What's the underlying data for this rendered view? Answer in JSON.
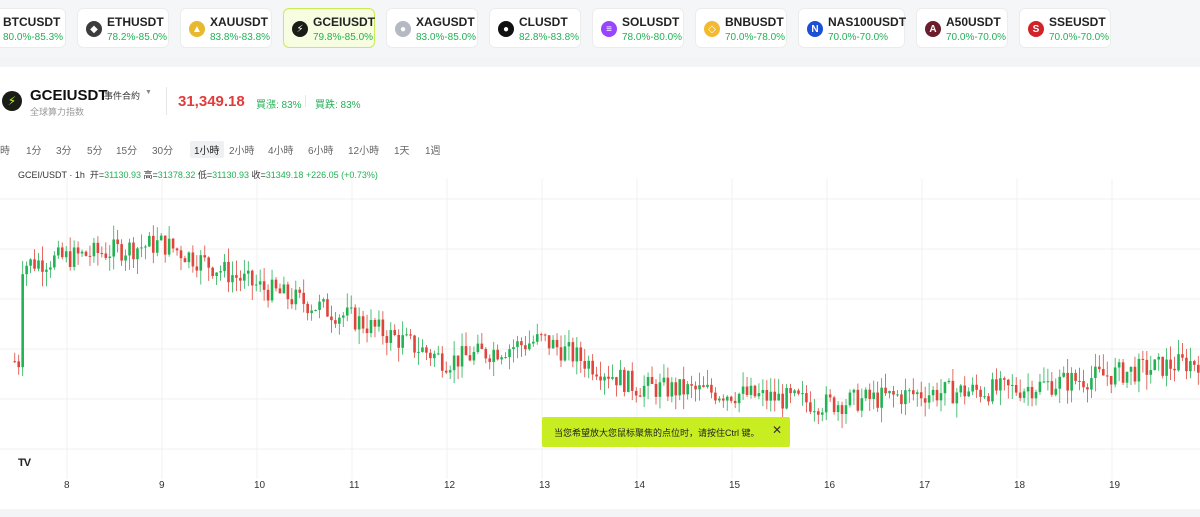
{
  "tickers": [
    {
      "symbol": "BTCUSDT",
      "range": "80.0%-85.3%",
      "icon": "bitcoin-icon",
      "icon_color": "#f7931a",
      "glyph": "₿"
    },
    {
      "symbol": "ETHUSDT",
      "range": "78.2%-85.0%",
      "icon": "ethereum-icon",
      "icon_color": "#3c3c3d",
      "glyph": "◆"
    },
    {
      "symbol": "XAUUSDT",
      "range": "83.8%-83.8%",
      "icon": "gold-icon",
      "icon_color": "#e8b92e",
      "glyph": "▲"
    },
    {
      "symbol": "GCEIUSDT",
      "range": "79.8%-85.0%",
      "icon": "lightning-icon",
      "icon_color": "#1a1d16",
      "glyph": "⚡"
    },
    {
      "symbol": "XAGUSDT",
      "range": "83.0%-85.0%",
      "icon": "silver-icon",
      "icon_color": "#b5b9c2",
      "glyph": "●"
    },
    {
      "symbol": "CLUSDT",
      "range": "82.8%-83.8%",
      "icon": "oil-drop-icon",
      "icon_color": "#111111",
      "glyph": "●"
    },
    {
      "symbol": "SOLUSDT",
      "range": "78.0%-80.0%",
      "icon": "solana-icon",
      "icon_color": "#9945ff",
      "glyph": "≡"
    },
    {
      "symbol": "BNBUSDT",
      "range": "70.0%-78.0%",
      "icon": "bnb-icon",
      "icon_color": "#f3ba2f",
      "glyph": "◇"
    },
    {
      "symbol": "NAS100USDT",
      "range": "70.0%-70.0%",
      "icon": "nas-icon",
      "icon_color": "#1a4fd6",
      "glyph": "N"
    },
    {
      "symbol": "A50USDT",
      "range": "70.0%-70.0%",
      "icon": "a50-icon",
      "icon_color": "#6b1d2b",
      "glyph": "A"
    },
    {
      "symbol": "SSEUSDT",
      "range": "70.0%-70.0%",
      "icon": "sse-icon",
      "icon_color": "#d2232a",
      "glyph": "S"
    }
  ],
  "header": {
    "symbol": "GCEIUSDT",
    "contract_type": "事件合約",
    "subtitle": "全球算力指数",
    "price": "31,349.18",
    "up_label": "買漲: 83%",
    "down_label": "買跌: 83%"
  },
  "timeframes": [
    "時",
    "1分",
    "3分",
    "5分",
    "15分",
    "30分",
    "1小時",
    "2小時",
    "4小時",
    "6小時",
    "12小時",
    "1天",
    "1週"
  ],
  "selected_timeframe": "1小時",
  "ohlc": {
    "pair": "GCEI/USDT · 1h",
    "open_label": "开=",
    "open": "31130.93",
    "high_label": "高=",
    "high": "31378.32",
    "low_label": "低=",
    "low": "31130.93",
    "close_label": "收=",
    "close": "31349.18",
    "change": "+226.05 (+0.73%)"
  },
  "toast": {
    "text": "当您希望放大您鼠标聚焦的点位时，请按住Ctrl 键。",
    "close_glyph": "✕"
  },
  "tv_logo": "TV",
  "chart_data": {
    "type": "candlestick",
    "x_ticks": [
      "8",
      "9",
      "10",
      "11",
      "12",
      "13",
      "14",
      "15",
      "16",
      "17",
      "18",
      "19"
    ],
    "colors": {
      "up": "#21b254",
      "down": "#e0453b"
    },
    "segments": [
      {
        "from_day": 7.5,
        "to_day": 9.0,
        "start": 31900,
        "end": 32000
      },
      {
        "from_day": 9.0,
        "to_day": 10.0,
        "start": 32000,
        "end": 31800
      },
      {
        "from_day": 10.0,
        "to_day": 11.0,
        "start": 31800,
        "end": 31650
      },
      {
        "from_day": 11.0,
        "to_day": 12.0,
        "start": 31650,
        "end": 31450
      },
      {
        "from_day": 12.0,
        "to_day": 13.0,
        "start": 31450,
        "end": 31550
      },
      {
        "from_day": 13.0,
        "to_day": 14.0,
        "start": 31550,
        "end": 31330
      },
      {
        "from_day": 14.0,
        "to_day": 15.0,
        "start": 31330,
        "end": 31300
      },
      {
        "from_day": 15.0,
        "to_day": 16.0,
        "start": 31300,
        "end": 31250
      },
      {
        "from_day": 16.0,
        "to_day": 17.0,
        "start": 31250,
        "end": 31300
      },
      {
        "from_day": 17.0,
        "to_day": 18.0,
        "start": 31300,
        "end": 31320
      },
      {
        "from_day": 18.0,
        "to_day": 19.9,
        "start": 31320,
        "end": 31450
      }
    ],
    "ylim": [
      30900,
      32300
    ],
    "grid": true
  }
}
